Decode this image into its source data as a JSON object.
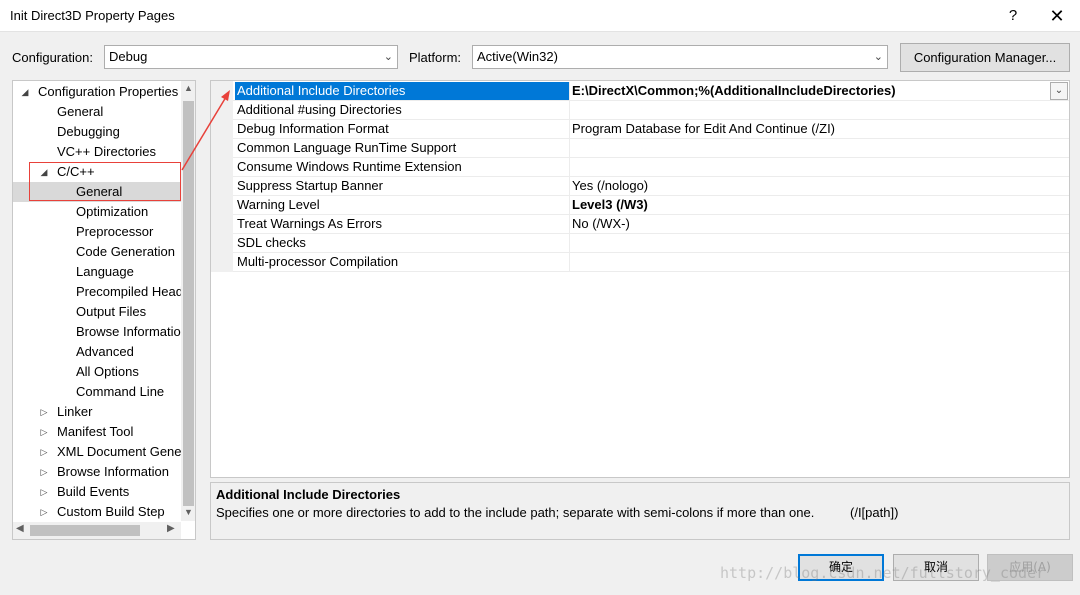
{
  "window": {
    "title": "Init Direct3D Property Pages",
    "help_glyph": "?",
    "close_glyph": "✕"
  },
  "config": {
    "config_label": "Configuration:",
    "config_value": "Debug",
    "platform_label": "Platform:",
    "platform_value": "Active(Win32)",
    "manager_button": "Configuration Manager..."
  },
  "tree": [
    {
      "label": "Configuration Properties",
      "indent": 0,
      "toggle": "expanded"
    },
    {
      "label": "General",
      "indent": 1
    },
    {
      "label": "Debugging",
      "indent": 1
    },
    {
      "label": "VC++ Directories",
      "indent": 1
    },
    {
      "label": "C/C++",
      "indent": 1,
      "toggle": "expanded"
    },
    {
      "label": "General",
      "indent": 2,
      "selected": true
    },
    {
      "label": "Optimization",
      "indent": 2
    },
    {
      "label": "Preprocessor",
      "indent": 2
    },
    {
      "label": "Code Generation",
      "indent": 2
    },
    {
      "label": "Language",
      "indent": 2
    },
    {
      "label": "Precompiled Head",
      "indent": 2
    },
    {
      "label": "Output Files",
      "indent": 2
    },
    {
      "label": "Browse Informatio",
      "indent": 2
    },
    {
      "label": "Advanced",
      "indent": 2
    },
    {
      "label": "All Options",
      "indent": 2
    },
    {
      "label": "Command Line",
      "indent": 2
    },
    {
      "label": "Linker",
      "indent": 1,
      "toggle": "collapsed"
    },
    {
      "label": "Manifest Tool",
      "indent": 1,
      "toggle": "collapsed"
    },
    {
      "label": "XML Document Gene",
      "indent": 1,
      "toggle": "collapsed"
    },
    {
      "label": "Browse Information",
      "indent": 1,
      "toggle": "collapsed"
    },
    {
      "label": "Build Events",
      "indent": 1,
      "toggle": "collapsed"
    },
    {
      "label": "Custom Build Step",
      "indent": 1,
      "toggle": "collapsed"
    }
  ],
  "properties": [
    {
      "name": "Additional Include Directories",
      "value": "E:\\DirectX\\Common;%(AdditionalIncludeDirectories)",
      "bold": true,
      "selected": true
    },
    {
      "name": "Additional #using Directories",
      "value": ""
    },
    {
      "name": "Debug Information Format",
      "value": "Program Database for Edit And Continue (/ZI)"
    },
    {
      "name": "Common Language RunTime Support",
      "value": ""
    },
    {
      "name": "Consume Windows Runtime Extension",
      "value": ""
    },
    {
      "name": "Suppress Startup Banner",
      "value": "Yes (/nologo)"
    },
    {
      "name": "Warning Level",
      "value": "Level3 (/W3)",
      "bold": true
    },
    {
      "name": "Treat Warnings As Errors",
      "value": "No (/WX-)"
    },
    {
      "name": "SDL checks",
      "value": ""
    },
    {
      "name": "Multi-processor Compilation",
      "value": ""
    }
  ],
  "description": {
    "title": "Additional Include Directories",
    "text": "Specifies one or more directories to add to the include path; separate with semi-colons if more than one.",
    "switch": "(/I[path])"
  },
  "buttons": {
    "ok": "确定",
    "cancel": "取消",
    "apply": "应用(A)"
  },
  "watermark": "http://blog.csdn.net/fullstory_coder",
  "colors": {
    "accent": "#0078d7",
    "annotation": "#e8413a",
    "selection_gray": "#d9d9d9"
  },
  "icons": {
    "tree_expanded": "◢",
    "tree_collapsed": "▷",
    "combo_arrow": "⌄",
    "dropdown_arrow": "⌄",
    "scroll_up": "▲",
    "scroll_down": "▼",
    "scroll_left": "◀",
    "scroll_right": "▶"
  }
}
